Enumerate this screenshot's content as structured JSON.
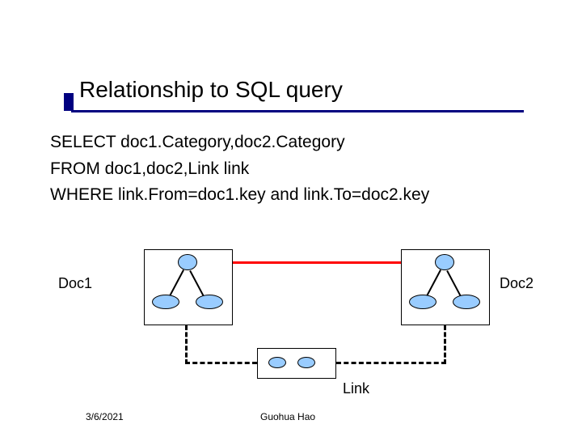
{
  "title": "Relationship to SQL query",
  "sql": {
    "line1": "SELECT doc1.Category,doc2.Category",
    "line2": "FROM doc1,doc2,Link link",
    "line3": "WHERE link.From=doc1.key and link.To=doc2.key"
  },
  "diagram": {
    "doc1_label": "Doc1",
    "doc2_label": "Doc2",
    "link_label": "Link"
  },
  "footer": {
    "date": "3/6/2021",
    "author": "Guohua Hao"
  }
}
